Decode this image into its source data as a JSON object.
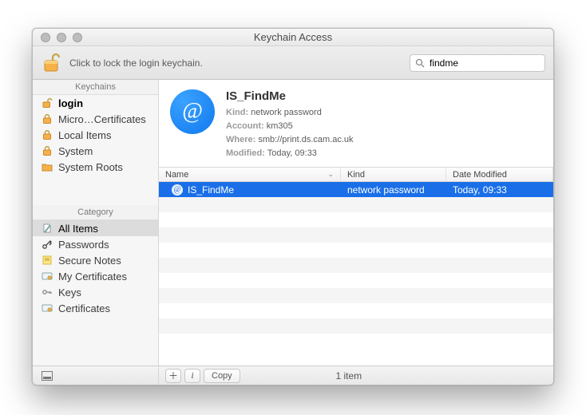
{
  "window": {
    "title": "Keychain Access"
  },
  "toolbar": {
    "lock_message": "Click to lock the login keychain.",
    "search_value": "findme"
  },
  "sidebar": {
    "keychains_header": "Keychains",
    "keychains": [
      {
        "label": "login",
        "icon": "lock-open-icon",
        "bold": true
      },
      {
        "label": "Micro…Certificates",
        "icon": "lock-icon"
      },
      {
        "label": "Local Items",
        "icon": "lock-icon"
      },
      {
        "label": "System",
        "icon": "lock-icon"
      },
      {
        "label": "System Roots",
        "icon": "folder-icon"
      }
    ],
    "category_header": "Category",
    "categories": [
      {
        "label": "All Items",
        "icon": "all-items-icon",
        "selected": true
      },
      {
        "label": "Passwords",
        "icon": "passwords-icon"
      },
      {
        "label": "Secure Notes",
        "icon": "secure-notes-icon"
      },
      {
        "label": "My Certificates",
        "icon": "my-certificates-icon"
      },
      {
        "label": "Keys",
        "icon": "keys-icon"
      },
      {
        "label": "Certificates",
        "icon": "certificates-icon"
      }
    ]
  },
  "detail": {
    "title": "IS_FindMe",
    "kind_label": "Kind:",
    "kind_value": "network password",
    "account_label": "Account:",
    "account_value": "km305",
    "where_label": "Where:",
    "where_value": "smb://print.ds.cam.ac.uk",
    "modified_label": "Modified:",
    "modified_value": "Today, 09:33"
  },
  "columns": {
    "name": "Name",
    "kind": "Kind",
    "date": "Date Modified"
  },
  "rows": [
    {
      "name": "IS_FindMe",
      "kind": "network password",
      "date": "Today, 09:33",
      "selected": true
    }
  ],
  "footer": {
    "copy_label": "Copy",
    "count": "1 item"
  }
}
